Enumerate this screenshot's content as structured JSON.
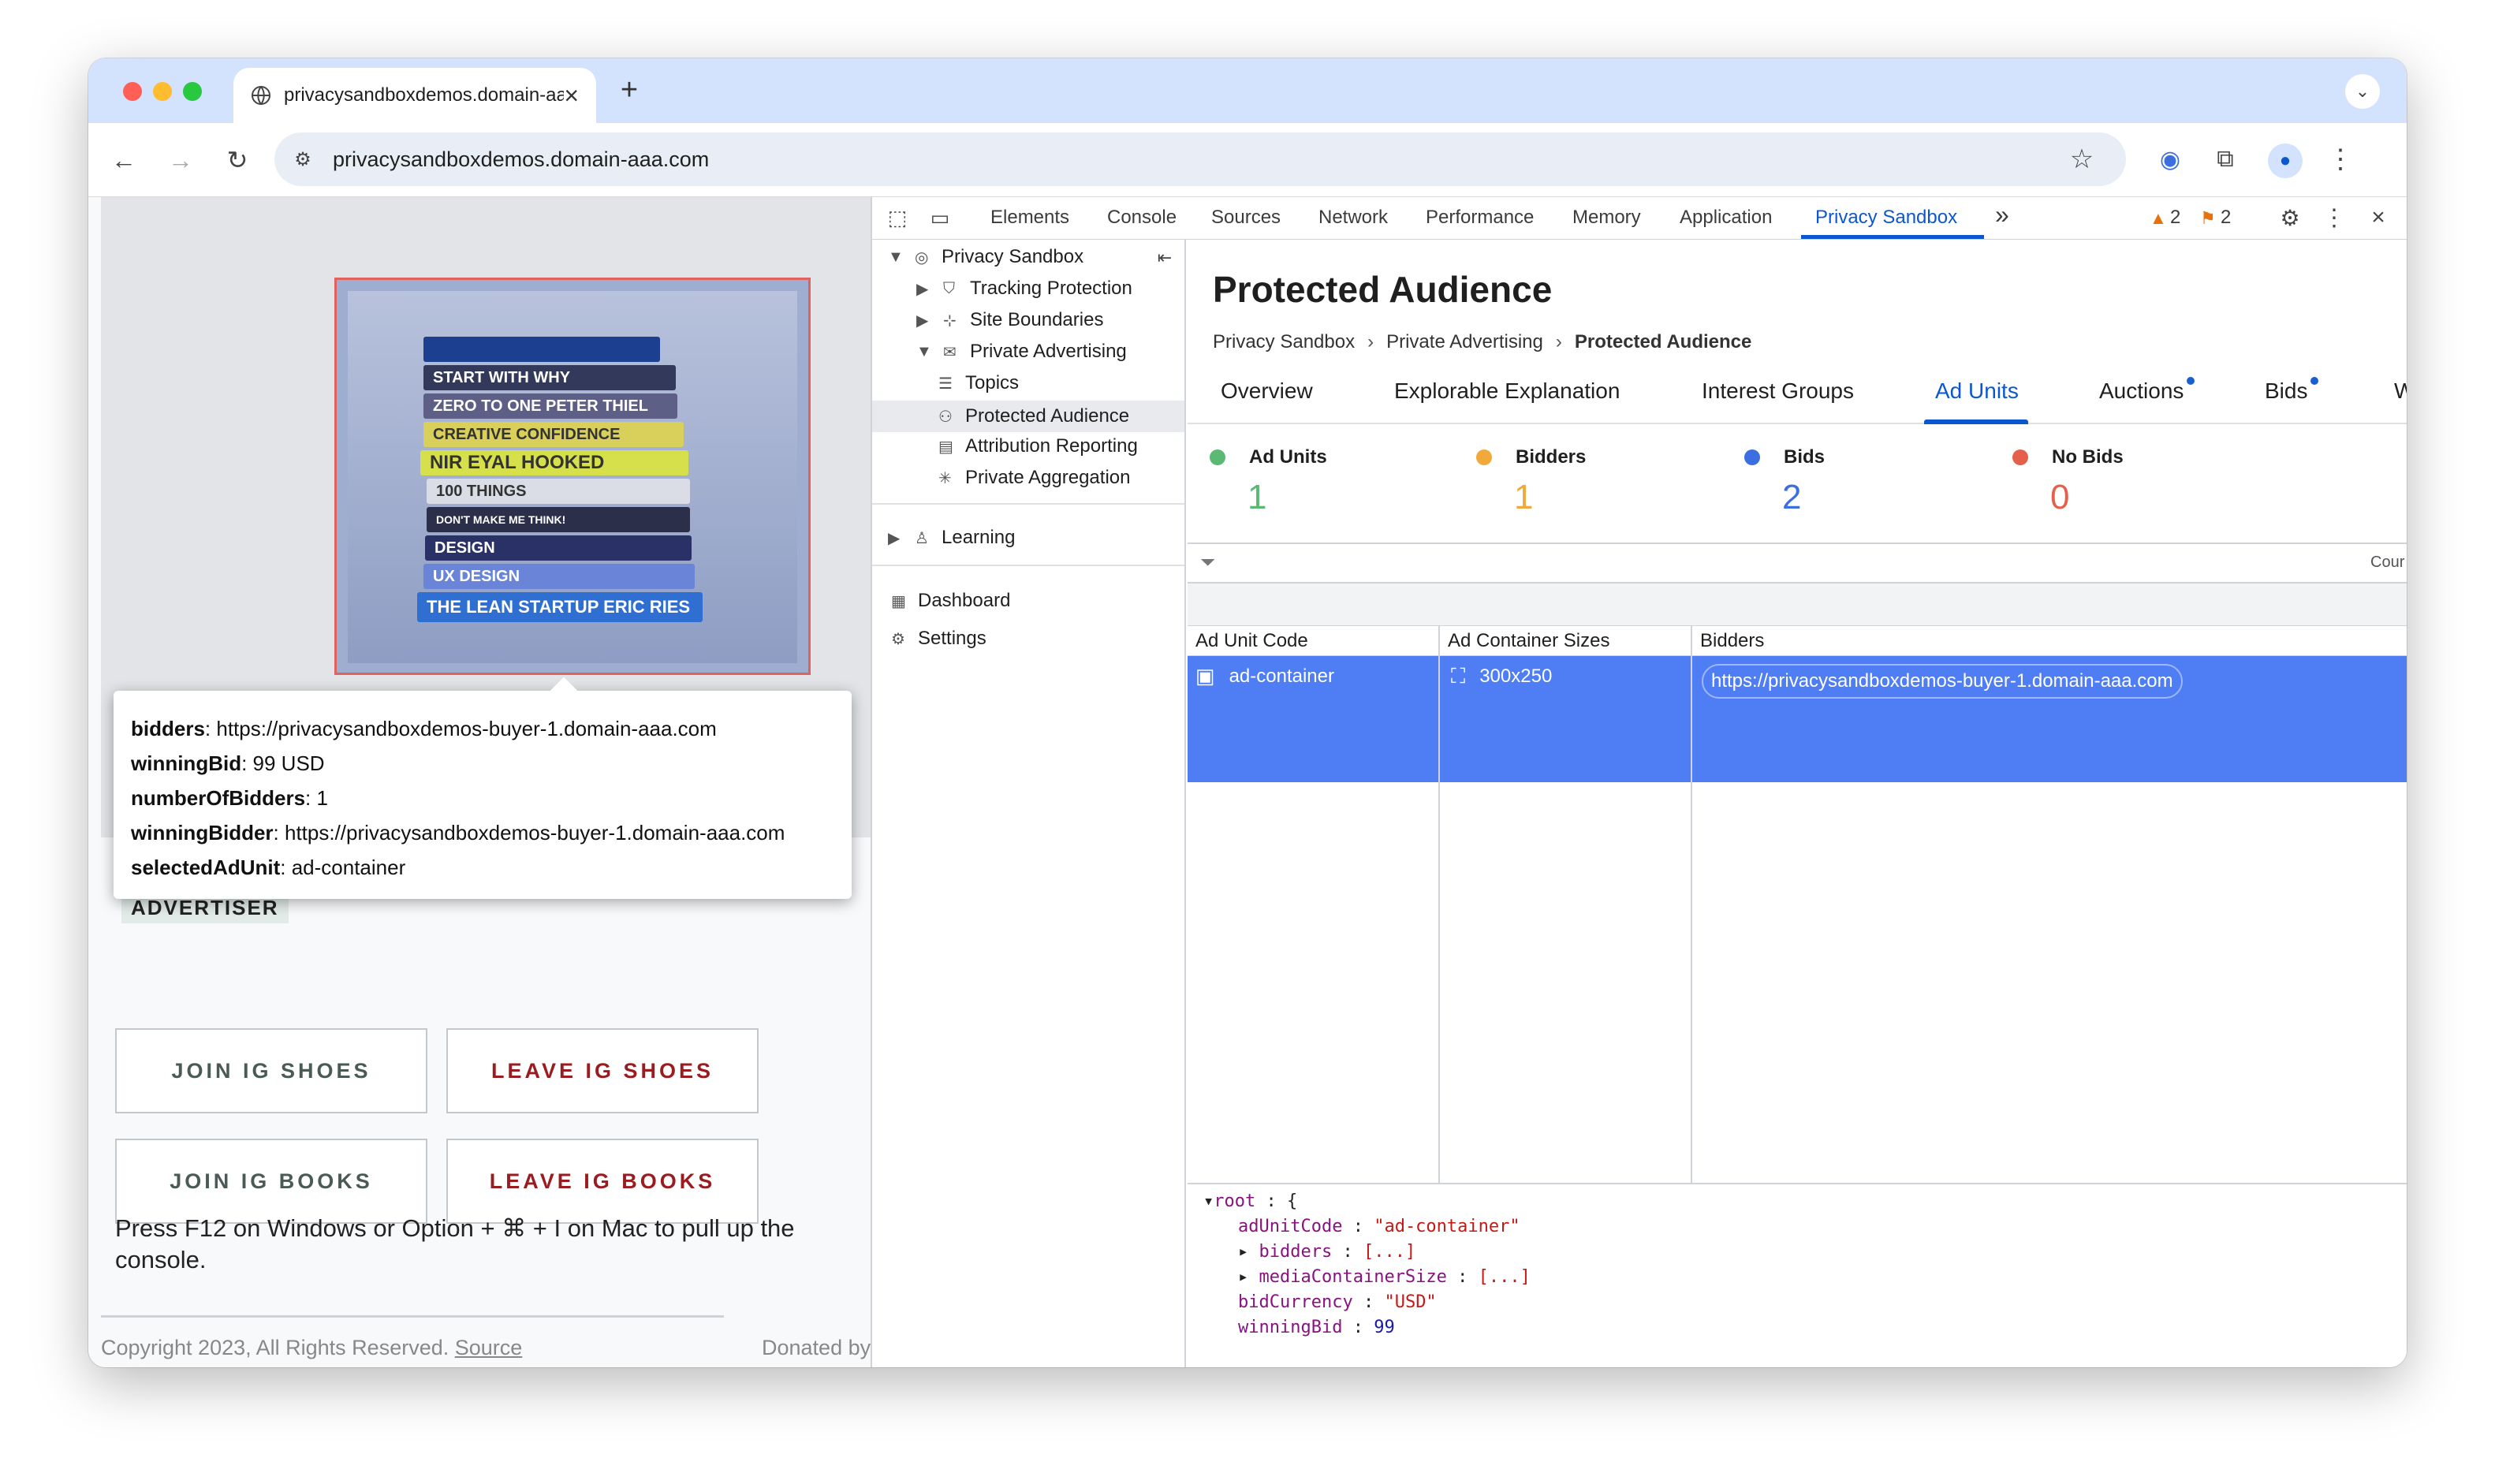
{
  "browser": {
    "tab_title": "privacysandboxdemos.domain-aaa.com",
    "tab_close": "×",
    "new_tab": "+",
    "url": "privacysandboxdemos.domain-aaa.com"
  },
  "page": {
    "tooltip": {
      "bidders_key": "bidders",
      "bidders_val": ": https://privacysandboxdemos-buyer-1.domain-aaa.com",
      "winningBid_key": "winningBid",
      "winningBid_val": ": 99 USD",
      "numberOfBidders_key": "numberOfBidders",
      "numberOfBidders_val": ": 1",
      "winningBidder_key": "winningBidder",
      "winningBidder_val": ": https://privacysandboxdemos-buyer-1.domain-aaa.com",
      "selectedAdUnit_key": "selectedAdUnit",
      "selectedAdUnit_val": ": ad-container"
    },
    "ad_books": [
      "START WITH WHY",
      "ZERO TO ONE  PETER THIEL",
      "CREATIVE CONFIDENCE",
      "NIR EYAL  HOOKED",
      "100 THINGS",
      "DON'T MAKE ME THINK!",
      "DESIGN",
      "UX DESIGN",
      "THE LEAN STARTUP  ERIC RIES"
    ],
    "advertiser_label": "ADVERTISER",
    "buttons": {
      "join_shoes": "JOIN IG SHOES",
      "leave_shoes": "LEAVE IG SHOES",
      "join_books": "JOIN IG BOOKS",
      "leave_books": "LEAVE IG BOOKS"
    },
    "instructions": "Press F12 on Windows or Option + ⌘ + I on Mac to pull up the console.",
    "copyright": "Copyright 2023, All Rights Reserved.",
    "source_link": "Source",
    "donated": "Donated by"
  },
  "devtools": {
    "tabs": [
      "Elements",
      "Console",
      "Sources",
      "Network",
      "Performance",
      "Memory",
      "Application",
      "Privacy Sandbox"
    ],
    "more_tabs": "»",
    "warnings": "2",
    "issues": "2",
    "sidebar": {
      "root": "Privacy Sandbox",
      "tracking": "Tracking Protection",
      "site_boundaries": "Site Boundaries",
      "private_advertising": "Private Advertising",
      "topics": "Topics",
      "protected_audience": "Protected Audience",
      "attribution": "Attribution Reporting",
      "aggregation": "Private Aggregation",
      "learning": "Learning",
      "dashboard": "Dashboard",
      "settings": "Settings"
    },
    "main": {
      "title": "Protected Audience",
      "breadcrumb": [
        "Privacy Sandbox",
        "Private Advertising",
        "Protected Audience"
      ],
      "nav_tabs": [
        "Overview",
        "Explorable Explanation",
        "Interest Groups",
        "Ad Units",
        "Auctions",
        "Bids",
        "W"
      ],
      "stats": [
        {
          "label": "Ad Units",
          "value": "1",
          "color": "#5bb974"
        },
        {
          "label": "Bidders",
          "value": "1",
          "color": "#f2a93b"
        },
        {
          "label": "Bids",
          "value": "2",
          "color": "#3b6fe0"
        },
        {
          "label": "No Bids",
          "value": "0",
          "color": "#e5604a"
        }
      ],
      "filter_right": "Cour",
      "table_headers": [
        "Ad Unit Code",
        "Ad Container Sizes",
        "Bidders"
      ],
      "row": {
        "code": "ad-container",
        "size": "300x250",
        "bidder": "https://privacysandboxdemos-buyer-1.domain-aaa.com"
      },
      "json_view": {
        "root": "root",
        "adUnitCode_key": "adUnitCode",
        "adUnitCode_val": "\"ad-container\"",
        "bidders_key": "bidders",
        "mediaContainerSize_key": "mediaContainerSize",
        "collapsed": "[...]",
        "bidCurrency_key": "bidCurrency",
        "bidCurrency_val": "\"USD\"",
        "winningBid_key": "winningBid",
        "winningBid_val": "99"
      }
    }
  }
}
